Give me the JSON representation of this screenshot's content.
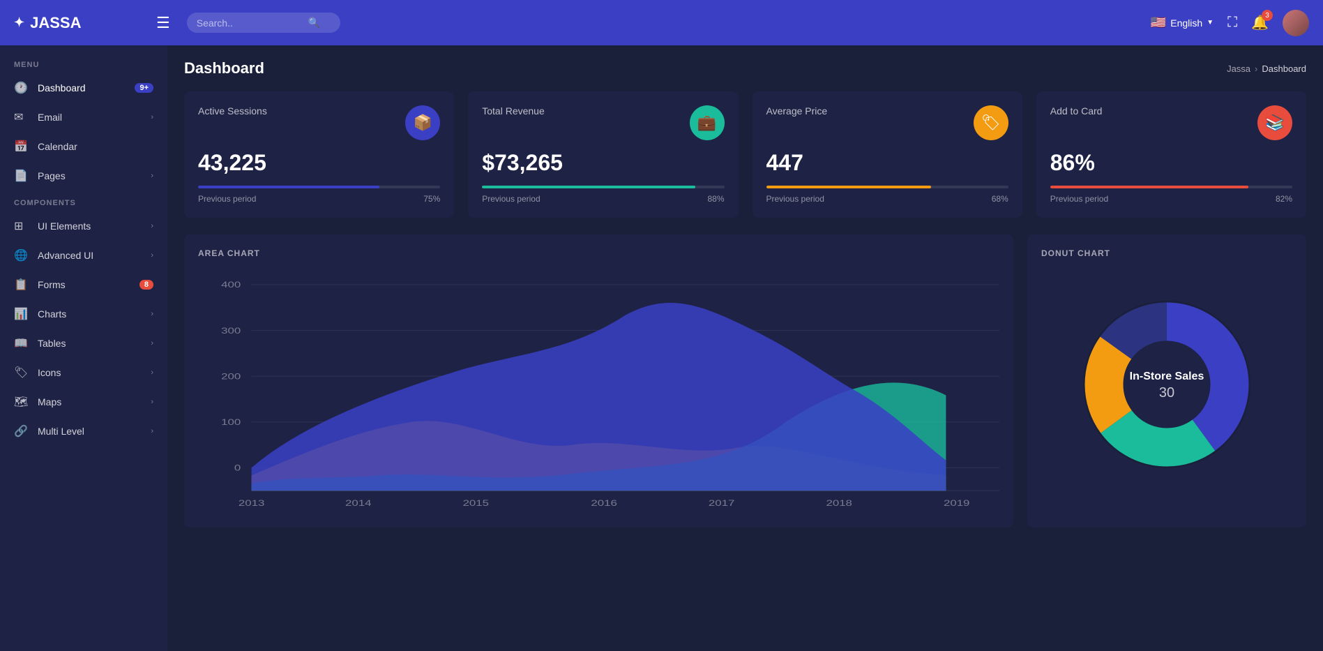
{
  "app": {
    "name": "JASSA",
    "logo_icon": "✦"
  },
  "topnav": {
    "search_placeholder": "Search..",
    "language": "English",
    "notif_count": "3"
  },
  "breadcrumb": {
    "parent": "Jassa",
    "current": "Dashboard"
  },
  "page": {
    "title": "Dashboard"
  },
  "sidebar": {
    "menu_label": "MENU",
    "components_label": "COMPONENTS",
    "items_menu": [
      {
        "id": "dashboard",
        "label": "Dashboard",
        "icon": "🕐",
        "badge": "9+",
        "badge_color": "blue"
      },
      {
        "id": "email",
        "label": "Email",
        "icon": "✉",
        "arrow": "›"
      },
      {
        "id": "calendar",
        "label": "Calendar",
        "icon": "📅",
        "arrow": ""
      },
      {
        "id": "pages",
        "label": "Pages",
        "icon": "📄",
        "arrow": "›"
      }
    ],
    "items_components": [
      {
        "id": "ui-elements",
        "label": "UI Elements",
        "icon": "⊞",
        "arrow": "›"
      },
      {
        "id": "advanced-ui",
        "label": "Advanced UI",
        "icon": "🌐",
        "arrow": "›"
      },
      {
        "id": "forms",
        "label": "Forms",
        "icon": "📋",
        "badge": "8",
        "badge_color": "red"
      },
      {
        "id": "charts",
        "label": "Charts",
        "icon": "📊",
        "arrow": "›"
      },
      {
        "id": "tables",
        "label": "Tables",
        "icon": "📖",
        "arrow": "›"
      },
      {
        "id": "icons",
        "label": "Icons",
        "icon": "🏷",
        "arrow": "›"
      },
      {
        "id": "maps",
        "label": "Maps",
        "icon": "🗺",
        "arrow": "›"
      },
      {
        "id": "multi-level",
        "label": "Multi Level",
        "icon": "🔗",
        "arrow": "›"
      }
    ]
  },
  "stat_cards": [
    {
      "label": "Active Sessions",
      "value": "43,225",
      "icon": "📦",
      "icon_class": "stat-icon-blue",
      "progress": 75,
      "progress_color": "#3a3fc4",
      "footer_label": "Previous period",
      "footer_value": "75%"
    },
    {
      "label": "Total Revenue",
      "value": "$73,265",
      "icon": "💼",
      "icon_class": "stat-icon-green",
      "progress": 88,
      "progress_color": "#1abc9c",
      "footer_label": "Previous period",
      "footer_value": "88%"
    },
    {
      "label": "Average Price",
      "value": "447",
      "icon": "🏷",
      "icon_class": "stat-icon-yellow",
      "progress": 68,
      "progress_color": "#f39c12",
      "footer_label": "Previous period",
      "footer_value": "68%"
    },
    {
      "label": "Add to Card",
      "value": "86%",
      "icon": "📚",
      "icon_class": "stat-icon-red",
      "progress": 82,
      "progress_color": "#e74c3c",
      "footer_label": "Previous period",
      "footer_value": "82%"
    }
  ],
  "area_chart": {
    "title": "AREA CHART",
    "y_labels": [
      "400",
      "300",
      "200",
      "100",
      "0"
    ],
    "x_labels": [
      "2013",
      "2014",
      "2015",
      "2016",
      "2017",
      "2018",
      "2019"
    ]
  },
  "donut_chart": {
    "title": "DONUT CHART",
    "center_label": "In-Store Sales",
    "center_value": "30",
    "segments": [
      {
        "color": "#3a3fc4",
        "value": 40
      },
      {
        "color": "#1abc9c",
        "value": 25
      },
      {
        "color": "#f39c12",
        "value": 20
      },
      {
        "color": "#2c3380",
        "value": 15
      }
    ]
  }
}
